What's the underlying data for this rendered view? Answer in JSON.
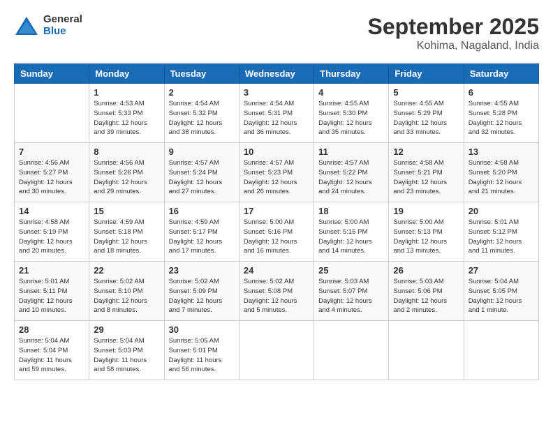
{
  "logo": {
    "general": "General",
    "blue": "Blue"
  },
  "title": "September 2025",
  "location": "Kohima, Nagaland, India",
  "days_of_week": [
    "Sunday",
    "Monday",
    "Tuesday",
    "Wednesday",
    "Thursday",
    "Friday",
    "Saturday"
  ],
  "weeks": [
    [
      {
        "day": "",
        "info": ""
      },
      {
        "day": "1",
        "info": "Sunrise: 4:53 AM\nSunset: 5:33 PM\nDaylight: 12 hours\nand 39 minutes."
      },
      {
        "day": "2",
        "info": "Sunrise: 4:54 AM\nSunset: 5:32 PM\nDaylight: 12 hours\nand 38 minutes."
      },
      {
        "day": "3",
        "info": "Sunrise: 4:54 AM\nSunset: 5:31 PM\nDaylight: 12 hours\nand 36 minutes."
      },
      {
        "day": "4",
        "info": "Sunrise: 4:55 AM\nSunset: 5:30 PM\nDaylight: 12 hours\nand 35 minutes."
      },
      {
        "day": "5",
        "info": "Sunrise: 4:55 AM\nSunset: 5:29 PM\nDaylight: 12 hours\nand 33 minutes."
      },
      {
        "day": "6",
        "info": "Sunrise: 4:55 AM\nSunset: 5:28 PM\nDaylight: 12 hours\nand 32 minutes."
      }
    ],
    [
      {
        "day": "7",
        "info": "Sunrise: 4:56 AM\nSunset: 5:27 PM\nDaylight: 12 hours\nand 30 minutes."
      },
      {
        "day": "8",
        "info": "Sunrise: 4:56 AM\nSunset: 5:26 PM\nDaylight: 12 hours\nand 29 minutes."
      },
      {
        "day": "9",
        "info": "Sunrise: 4:57 AM\nSunset: 5:24 PM\nDaylight: 12 hours\nand 27 minutes."
      },
      {
        "day": "10",
        "info": "Sunrise: 4:57 AM\nSunset: 5:23 PM\nDaylight: 12 hours\nand 26 minutes."
      },
      {
        "day": "11",
        "info": "Sunrise: 4:57 AM\nSunset: 5:22 PM\nDaylight: 12 hours\nand 24 minutes."
      },
      {
        "day": "12",
        "info": "Sunrise: 4:58 AM\nSunset: 5:21 PM\nDaylight: 12 hours\nand 23 minutes."
      },
      {
        "day": "13",
        "info": "Sunrise: 4:58 AM\nSunset: 5:20 PM\nDaylight: 12 hours\nand 21 minutes."
      }
    ],
    [
      {
        "day": "14",
        "info": "Sunrise: 4:58 AM\nSunset: 5:19 PM\nDaylight: 12 hours\nand 20 minutes."
      },
      {
        "day": "15",
        "info": "Sunrise: 4:59 AM\nSunset: 5:18 PM\nDaylight: 12 hours\nand 18 minutes."
      },
      {
        "day": "16",
        "info": "Sunrise: 4:59 AM\nSunset: 5:17 PM\nDaylight: 12 hours\nand 17 minutes."
      },
      {
        "day": "17",
        "info": "Sunrise: 5:00 AM\nSunset: 5:16 PM\nDaylight: 12 hours\nand 16 minutes."
      },
      {
        "day": "18",
        "info": "Sunrise: 5:00 AM\nSunset: 5:15 PM\nDaylight: 12 hours\nand 14 minutes."
      },
      {
        "day": "19",
        "info": "Sunrise: 5:00 AM\nSunset: 5:13 PM\nDaylight: 12 hours\nand 13 minutes."
      },
      {
        "day": "20",
        "info": "Sunrise: 5:01 AM\nSunset: 5:12 PM\nDaylight: 12 hours\nand 11 minutes."
      }
    ],
    [
      {
        "day": "21",
        "info": "Sunrise: 5:01 AM\nSunset: 5:11 PM\nDaylight: 12 hours\nand 10 minutes."
      },
      {
        "day": "22",
        "info": "Sunrise: 5:02 AM\nSunset: 5:10 PM\nDaylight: 12 hours\nand 8 minutes."
      },
      {
        "day": "23",
        "info": "Sunrise: 5:02 AM\nSunset: 5:09 PM\nDaylight: 12 hours\nand 7 minutes."
      },
      {
        "day": "24",
        "info": "Sunrise: 5:02 AM\nSunset: 5:08 PM\nDaylight: 12 hours\nand 5 minutes."
      },
      {
        "day": "25",
        "info": "Sunrise: 5:03 AM\nSunset: 5:07 PM\nDaylight: 12 hours\nand 4 minutes."
      },
      {
        "day": "26",
        "info": "Sunrise: 5:03 AM\nSunset: 5:06 PM\nDaylight: 12 hours\nand 2 minutes."
      },
      {
        "day": "27",
        "info": "Sunrise: 5:04 AM\nSunset: 5:05 PM\nDaylight: 12 hours\nand 1 minute."
      }
    ],
    [
      {
        "day": "28",
        "info": "Sunrise: 5:04 AM\nSunset: 5:04 PM\nDaylight: 11 hours\nand 59 minutes."
      },
      {
        "day": "29",
        "info": "Sunrise: 5:04 AM\nSunset: 5:03 PM\nDaylight: 11 hours\nand 58 minutes."
      },
      {
        "day": "30",
        "info": "Sunrise: 5:05 AM\nSunset: 5:01 PM\nDaylight: 11 hours\nand 56 minutes."
      },
      {
        "day": "",
        "info": ""
      },
      {
        "day": "",
        "info": ""
      },
      {
        "day": "",
        "info": ""
      },
      {
        "day": "",
        "info": ""
      }
    ]
  ]
}
